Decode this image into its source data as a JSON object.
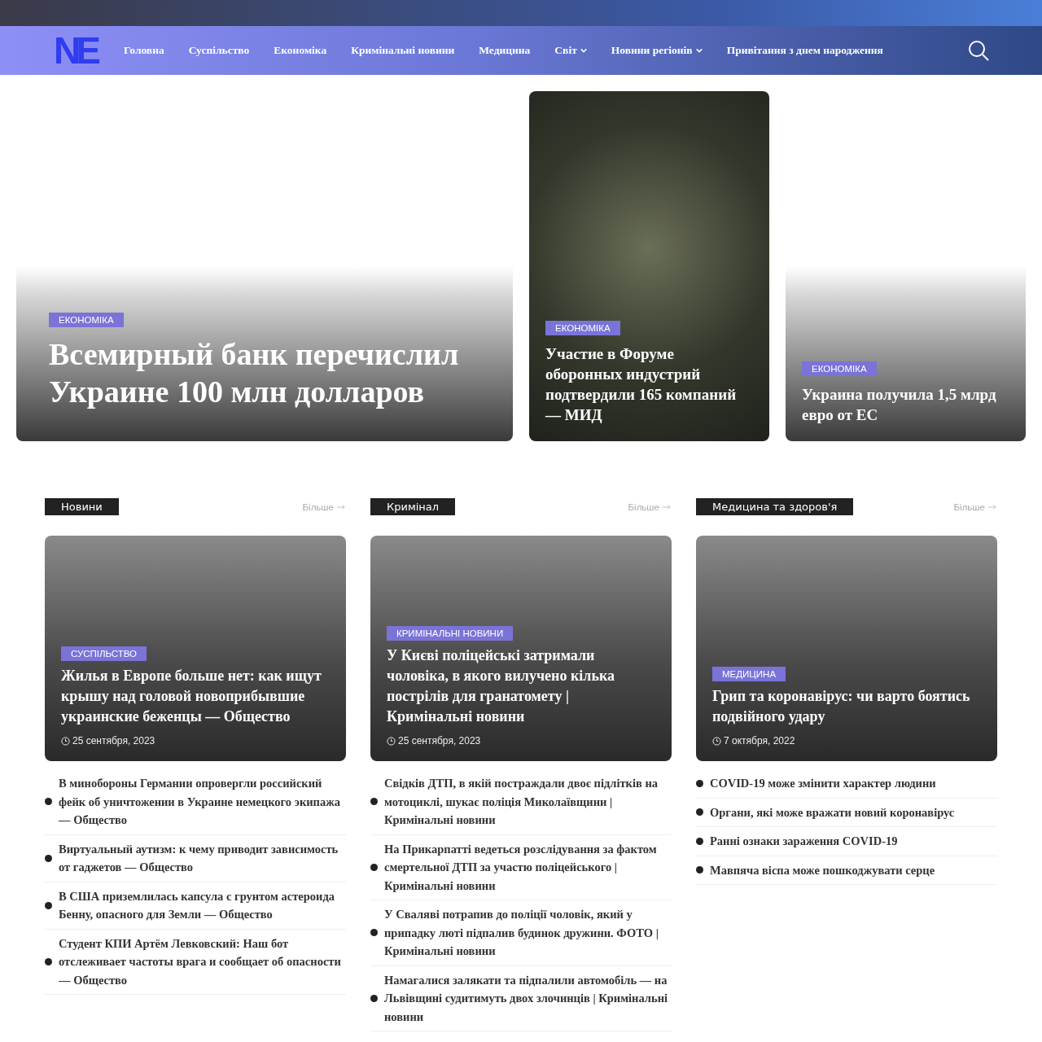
{
  "header": {
    "logo": "NE",
    "nav": [
      {
        "label": "Головна",
        "dropdown": false
      },
      {
        "label": "Суспільство",
        "dropdown": false
      },
      {
        "label": "Економіка",
        "dropdown": false
      },
      {
        "label": "Кримінальні новини",
        "dropdown": false
      },
      {
        "label": "Медицина",
        "dropdown": false
      },
      {
        "label": "Світ",
        "dropdown": true
      },
      {
        "label": "Новини регіонів",
        "dropdown": true
      },
      {
        "label": "Привітання з днем народження",
        "dropdown": false
      }
    ]
  },
  "hero": [
    {
      "kind": "large",
      "photo": false,
      "category": "ЕКОНОМІКА",
      "title": "Всемирный банк перечислил Украине 100 млн долларов"
    },
    {
      "kind": "small",
      "photo": true,
      "category": "ЕКОНОМІКА",
      "title": "Участие в Форуме оборонных индустрий подтвердили 165 компаний — МИД"
    },
    {
      "kind": "small",
      "photo": false,
      "category": "ЕКОНОМІКА",
      "title": "Украина получила 1,5 млрд евро от ЕС"
    }
  ],
  "sections": [
    {
      "title": "Новини",
      "more": "Більше",
      "feature": {
        "category": "СУСПІЛЬСТВО",
        "title": "Жилья в Европе больше нет: как ищут крышу над головой новоприбывшие украинские беженцы — Общество",
        "date": "25 сентября, 2023"
      },
      "items": [
        "В минобороны Германии опровергли российский фейк об уничтожении в Украине немецкого экипажа — Общество",
        "Виртуальный аутизм: к чему приводит зависимость от гаджетов — Общество",
        "В США приземлилась капсула с грунтом астероида Бенну, опасного для Земли — Общество",
        "Студент КПИ Артём Левковский: Наш бот отслеживает частоты врага и сообщает об опасности — Общество"
      ]
    },
    {
      "title": "Кримінал",
      "more": "Більше",
      "feature": {
        "category": "КРИМІНАЛЬНІ НОВИНИ",
        "title": "У Києві поліцейські затримали чоловіка, в якого вилучено кілька пострілів для гранатомету | Кримінальні новини",
        "date": "25 сентября, 2023"
      },
      "items": [
        "Свідків ДТП, в якій постраждали двоє підлітків на мотоциклі, шукає поліція Миколаївщини | Кримінальні новини",
        "На Прикарпатті ведеться розслідування за фактом смертельної ДТП за участю поліцейського | Кримінальні новини",
        "У Сваляві потрапив до поліції чоловік, який у припадку люті підпалив будинок дружини. ФОТО | Кримінальні новини",
        "Намагалися залякати та підпалили автомобіль — на Львівщині судитимуть двох злочинців | Кримінальні новини"
      ]
    },
    {
      "title": "Медицина та здоров'я",
      "more": "Більше",
      "feature": {
        "category": "МЕДИЦИНА",
        "title": "Грип та коронавірус: чи варто боятись подвійного удару",
        "date": "7 октября, 2022"
      },
      "items": [
        "COVID-19 може змінити характер людини",
        "Органи, які може вражати новий коронавірус",
        "Ранні ознаки зараження COVID-19",
        "Мавпяча віспа може пошкоджувати серце"
      ]
    }
  ]
}
